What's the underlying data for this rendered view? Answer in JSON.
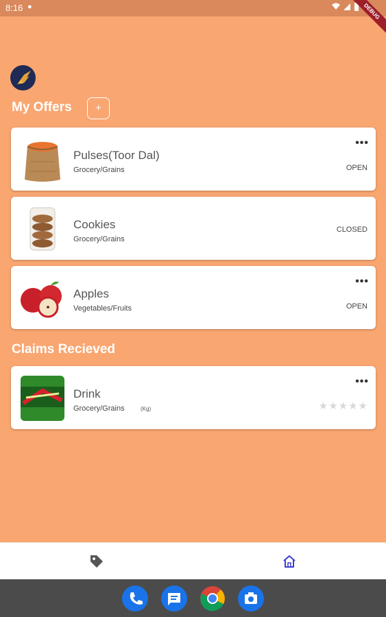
{
  "status_bar": {
    "time": "8:16",
    "debug_label": "DEBUG"
  },
  "header": {
    "avatar_icon": "wing-logo-icon"
  },
  "offers": {
    "title": "My Offers",
    "add_label": "+",
    "items": [
      {
        "title": "Pulses(Toor Dal)",
        "category": "Grocery/Grains",
        "status": "OPEN",
        "has_menu": true,
        "image": "grain-sack-image"
      },
      {
        "title": "Cookies",
        "category": "Grocery/Grains",
        "status": "CLOSED",
        "has_menu": false,
        "image": "cookies-pack-image"
      },
      {
        "title": "Apples",
        "category": "Vegetables/Fruits",
        "status": "OPEN",
        "has_menu": true,
        "image": "apples-image"
      }
    ]
  },
  "claims": {
    "title": "Claims Recieved",
    "items": [
      {
        "title": "Drink",
        "category": "Grocery/Grains",
        "tag": "(Kg)",
        "rating": 0,
        "max_rating": 5,
        "image": "soda-bottle-image"
      }
    ]
  },
  "menu_glyph": "•••",
  "star_glyph": "★",
  "bottom_nav": [
    {
      "name": "tag-icon",
      "active": false
    },
    {
      "name": "home-icon",
      "active": true
    }
  ],
  "colors": {
    "background": "#f9a671",
    "active_nav": "#3d3dd6",
    "inactive_nav": "#555555"
  },
  "dock": [
    "phone-icon",
    "messages-icon",
    "chrome-icon",
    "camera-icon"
  ]
}
